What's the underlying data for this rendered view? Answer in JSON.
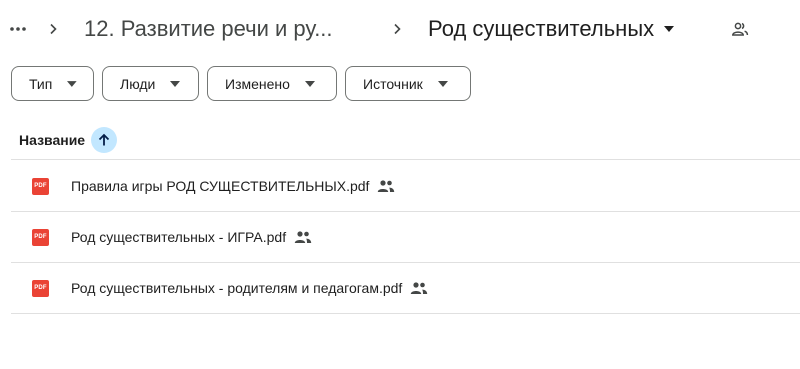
{
  "breadcrumb": {
    "parent_label": "12. Развитие речи и ру...",
    "current_label": "Род существительных"
  },
  "filters": {
    "type": "Тип",
    "people": "Люди",
    "modified": "Изменено",
    "source": "Источник"
  },
  "table": {
    "name_header": "Название"
  },
  "files": [
    {
      "name": "Правила игры РОД СУЩЕСТВИТЕЛЬНЫХ.pdf",
      "icon_text": "PDF"
    },
    {
      "name": "Род существительных - ИГРА.pdf",
      "icon_text": "PDF"
    },
    {
      "name": "Род существительных - родителям и педагогам.pdf",
      "icon_text": "PDF"
    }
  ],
  "colors": {
    "pdf_red": "#ea4335",
    "sort_bg": "#c2e7ff",
    "divider": "#e0e0e0"
  }
}
